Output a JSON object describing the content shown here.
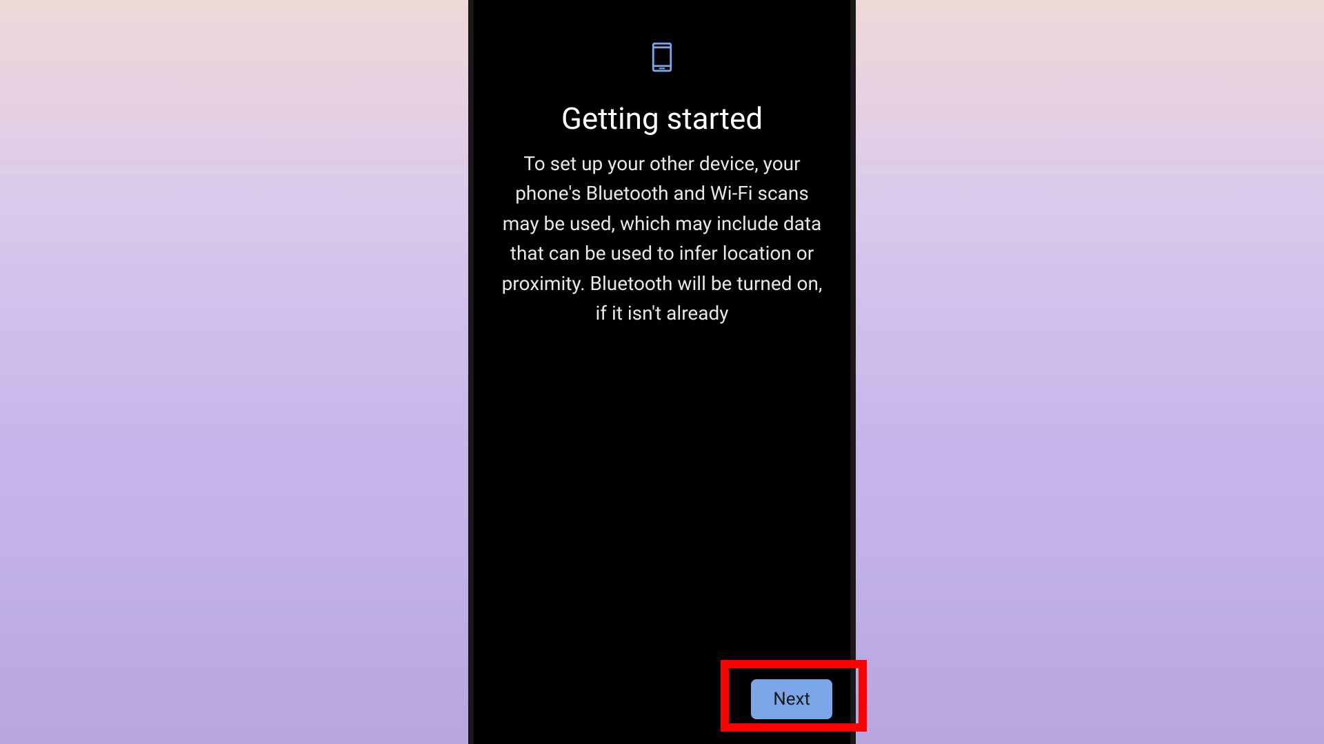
{
  "screen": {
    "title": "Getting started",
    "description": "To set up your other device, your phone's Bluetooth and Wi-Fi scans may be used, which may include data that can be used to infer location or proximity. Bluetooth will be turned on, if it isn't already",
    "next_button_label": "Next",
    "icon_name": "phone-icon",
    "accent_color": "#7ba7e8",
    "highlight_color": "#ff0000"
  }
}
